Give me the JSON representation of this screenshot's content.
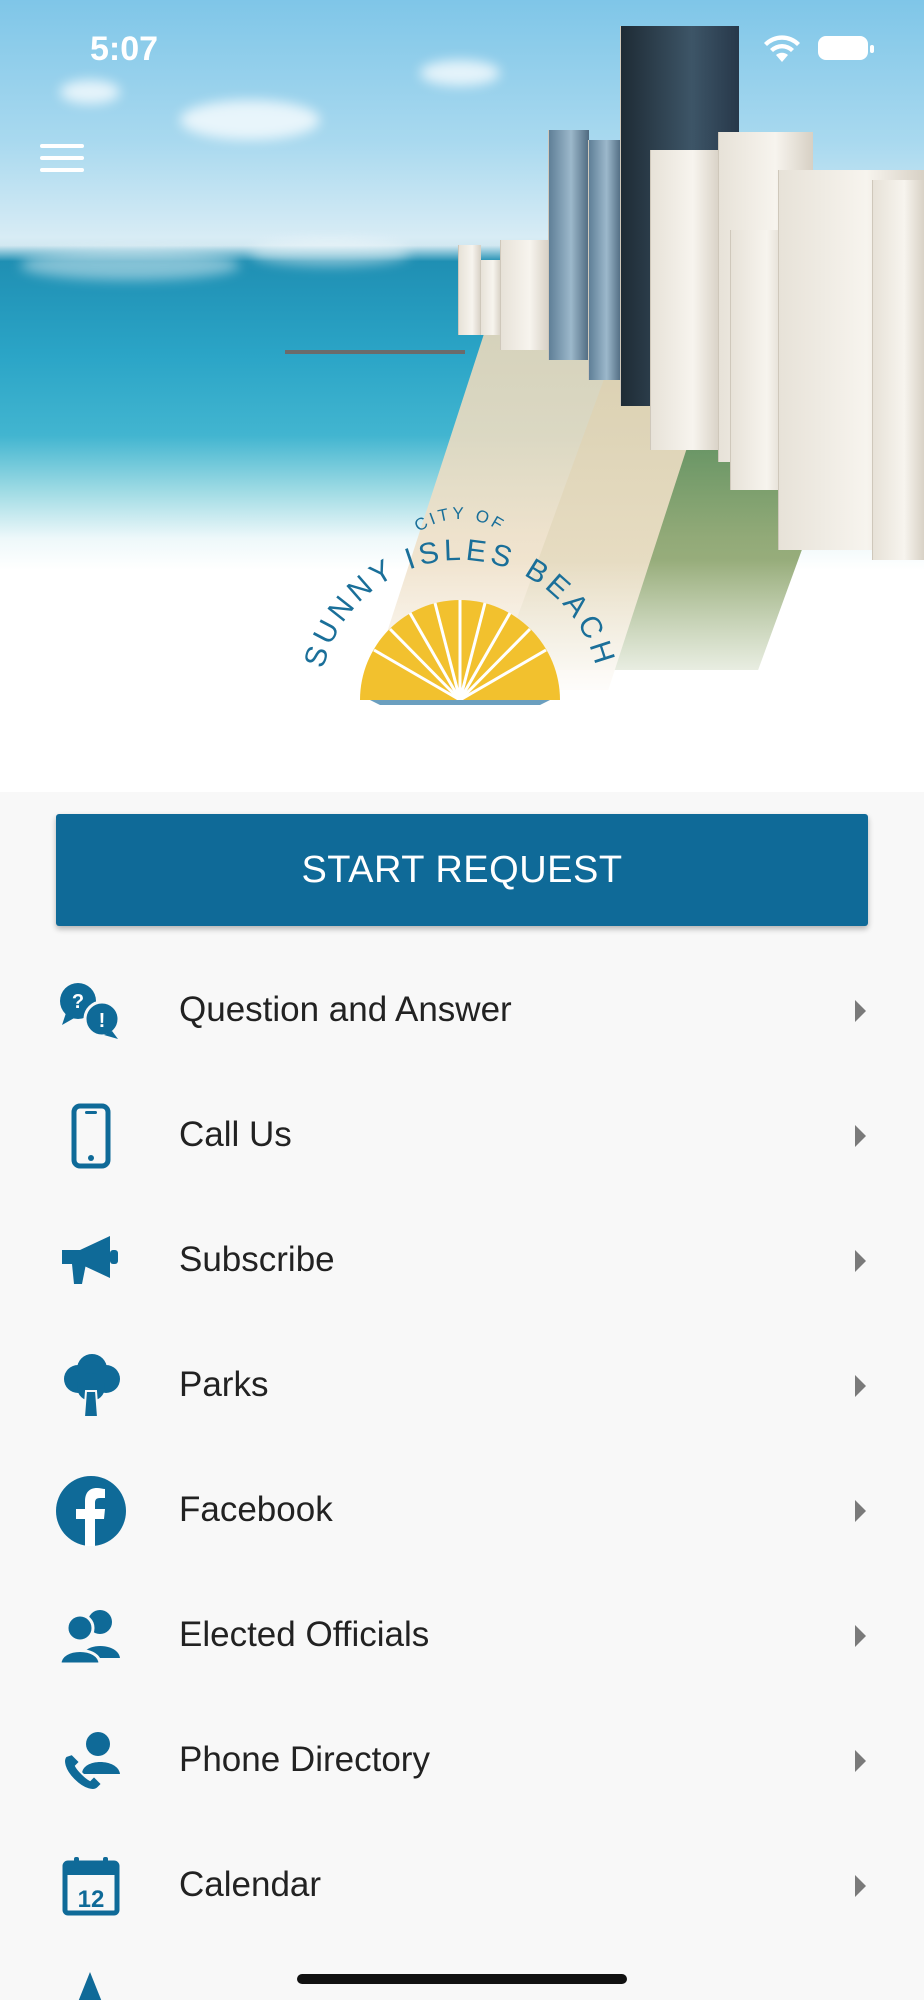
{
  "status_bar": {
    "time": "5:07"
  },
  "logo": {
    "top_text": "CITY OF",
    "arc_text": "SUNNY ISLES BEACH"
  },
  "primary_action": {
    "label": "START REQUEST"
  },
  "menu_items": [
    {
      "label": "Question and Answer",
      "icon": "question-answer-icon"
    },
    {
      "label": "Call Us",
      "icon": "mobile-phone-icon"
    },
    {
      "label": "Subscribe",
      "icon": "megaphone-icon"
    },
    {
      "label": "Parks",
      "icon": "tree-icon"
    },
    {
      "label": "Facebook",
      "icon": "facebook-icon"
    },
    {
      "label": "Elected Officials",
      "icon": "officials-icon"
    },
    {
      "label": "Phone Directory",
      "icon": "phone-directory-icon"
    },
    {
      "label": "Calendar",
      "icon": "calendar-icon"
    }
  ],
  "colors": {
    "brand_blue": "#0f6a98",
    "sun_yellow": "#f2c12e",
    "background": "#f8f8f8"
  }
}
